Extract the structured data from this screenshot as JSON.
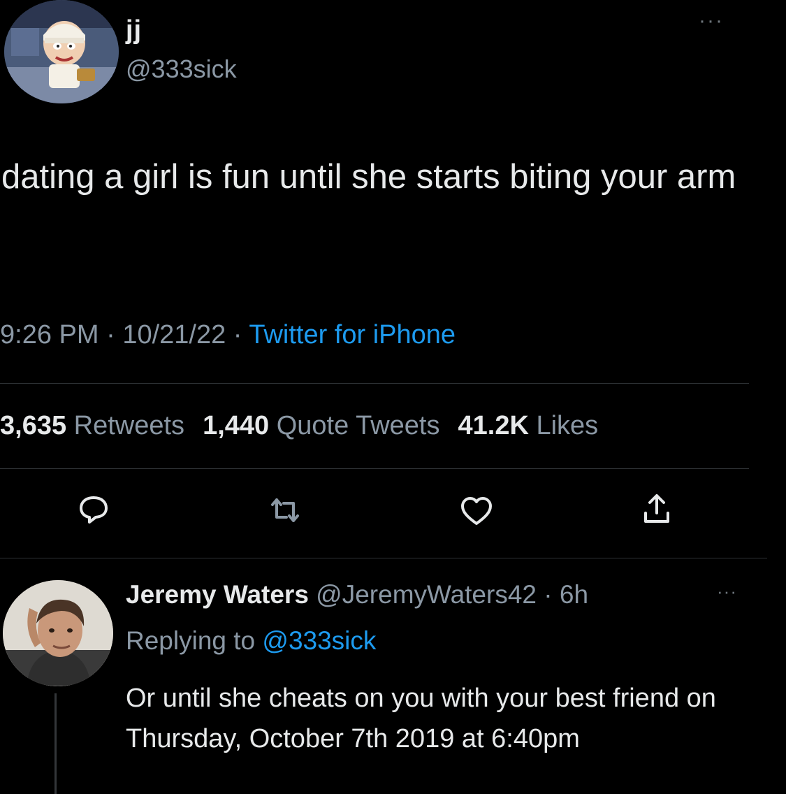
{
  "tweet": {
    "author": {
      "display_name": "jj",
      "handle": "@333sick"
    },
    "more_icon": "ellipsis-icon",
    "text": "dating a girl is fun until she starts biting your arm",
    "time": "9:26 PM",
    "separator": "·",
    "date": "10/21/22",
    "source": "Twitter for iPhone",
    "stats": {
      "retweets_count": "3,635",
      "retweets_label": "Retweets",
      "quotes_count": "1,440",
      "quotes_label": "Quote Tweets",
      "likes_count": "41.2K",
      "likes_label": "Likes"
    },
    "actions": {
      "reply_icon": "reply-icon",
      "retweet_icon": "retweet-icon",
      "like_icon": "heart-icon",
      "share_icon": "share-icon"
    }
  },
  "reply": {
    "display_name": "Jeremy Waters",
    "handle": "@JeremyWaters42",
    "separator": "·",
    "age": "6h",
    "more_icon": "ellipsis-icon",
    "replying_label": "Replying to",
    "replying_to": "@333sick",
    "text": "Or until she cheats on you with your best friend on Thursday, October 7th 2019 at 6:40pm"
  },
  "colors": {
    "background": "#000000",
    "primary_text": "#e7e9ea",
    "secondary_text": "#8b98a5",
    "accent": "#1d9bf0",
    "divider": "#2f3336"
  }
}
